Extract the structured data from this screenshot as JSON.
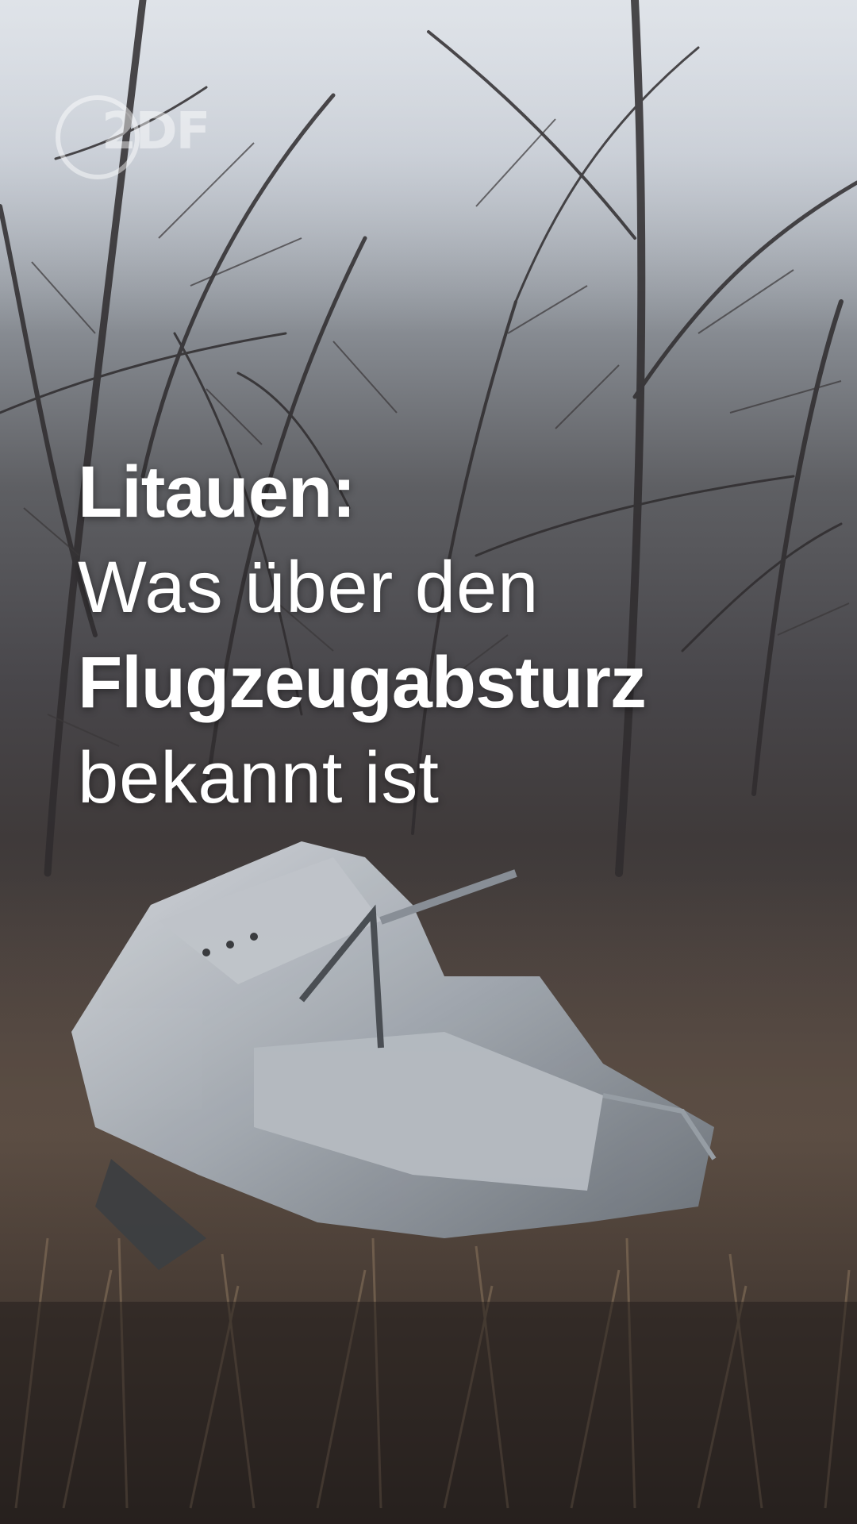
{
  "brand": {
    "logo_text": "2DF",
    "logo_icon": "zdf-logo-icon"
  },
  "headline": {
    "line1": "Litauen:",
    "line2": "Was über den",
    "line3": "Flugzeugabsturz",
    "line4": "bekannt ist"
  },
  "scene": {
    "description_icons": [
      "bare-trees",
      "aircraft-wreckage",
      "dry-grass"
    ],
    "colors": {
      "sky": "#c9ced6",
      "wreckage": "#9aa2aa",
      "text": "#ffffff"
    }
  }
}
